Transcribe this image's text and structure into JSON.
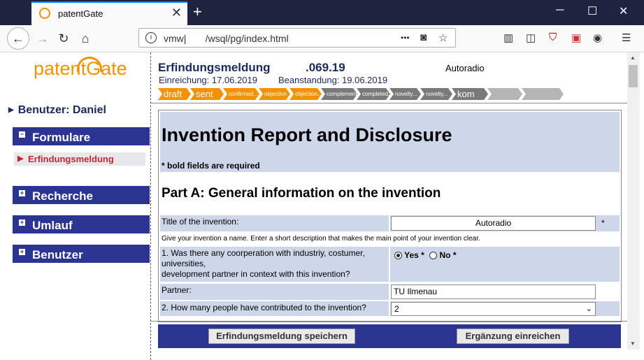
{
  "browser": {
    "tab_title": "patentGate",
    "url": "vmw|       /wsql/pg/index.html",
    "new_tab": "+",
    "close_tab": "✕",
    "page_actions": "•••"
  },
  "sidebar": {
    "logo": "patentGate",
    "user": "Benutzer: Daniel",
    "menus": [
      {
        "label": "Formulare",
        "sign": "−"
      },
      {
        "label": "Recherche",
        "sign": "+"
      },
      {
        "label": "Umlauf",
        "sign": "+"
      },
      {
        "label": "Benutzer",
        "sign": "+"
      }
    ],
    "active_item": "Erfindungsmeldung"
  },
  "header": {
    "title": "Erfindungsmeldung",
    "id": ".069.19",
    "topic": "Autoradio",
    "submission_date": "Einreichung: 17.06.2019",
    "objection_date": "Beanstandung: 19.06.2019"
  },
  "workflow_steps": [
    {
      "label": "draft",
      "color": "#f39200"
    },
    {
      "label": "sent",
      "color": "#f39200"
    },
    {
      "label": "confirmed...",
      "color": "#f39200"
    },
    {
      "label": "objection",
      "color": "#f39200"
    },
    {
      "label": "objection...",
      "color": "#f39200"
    },
    {
      "label": "complement...",
      "color": "#7a7a7a"
    },
    {
      "label": "completed...",
      "color": "#7a7a7a"
    },
    {
      "label": "novelty...",
      "color": "#7a7a7a"
    },
    {
      "label": "novelty...",
      "color": "#7a7a7a"
    },
    {
      "label": "kom",
      "color": "#7a7a7a"
    },
    {
      "label": "",
      "color": "#b5b5b5"
    },
    {
      "label": "",
      "color": "#b5b5b5"
    }
  ],
  "form": {
    "heading": "Invention Report and Disclosure",
    "required_note": "* bold fields are required",
    "part_a": "Part A: General information on the invention",
    "title_label": "Title of the invention:",
    "title_value": "Autoradio",
    "required_star": "*",
    "title_hint": "Give your invention a name. Enter a short description that makes the main point of your invention clear.",
    "q1_line1": "1. Was there any coorperation with industriy, costumer, universities,",
    "q1_line2": "development partner in context with this invention?",
    "q1_yes": "Yes *",
    "q1_no": "No *",
    "partner_label": "Partner:",
    "partner_value": "TU Ilmenau",
    "q2_label": "2. How many people have contributed to the invention?",
    "q2_value": "2"
  },
  "footer": {
    "save_label": "Erfindungsmeldung speichern",
    "submit_label": "Ergänzung einreichen"
  }
}
